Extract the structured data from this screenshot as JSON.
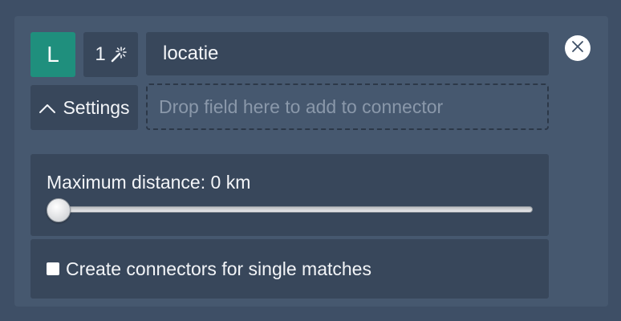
{
  "connector": {
    "badge_letter": "L",
    "badge_color": "#1f8f7d",
    "match_count": "1",
    "match_icon": "magic-wand-icon",
    "field_name": "locatie",
    "close_icon": "close-circle-icon"
  },
  "settings": {
    "label": "Settings",
    "icon": "chevron-up-icon",
    "expanded": true
  },
  "drop_zone": {
    "placeholder": "Drop field here to add to connector"
  },
  "distance": {
    "label": "Maximum distance: 0 km",
    "value": 0,
    "min": 0,
    "max": 100
  },
  "single_matches": {
    "label": "Create connectors for single matches",
    "checked": false
  }
}
